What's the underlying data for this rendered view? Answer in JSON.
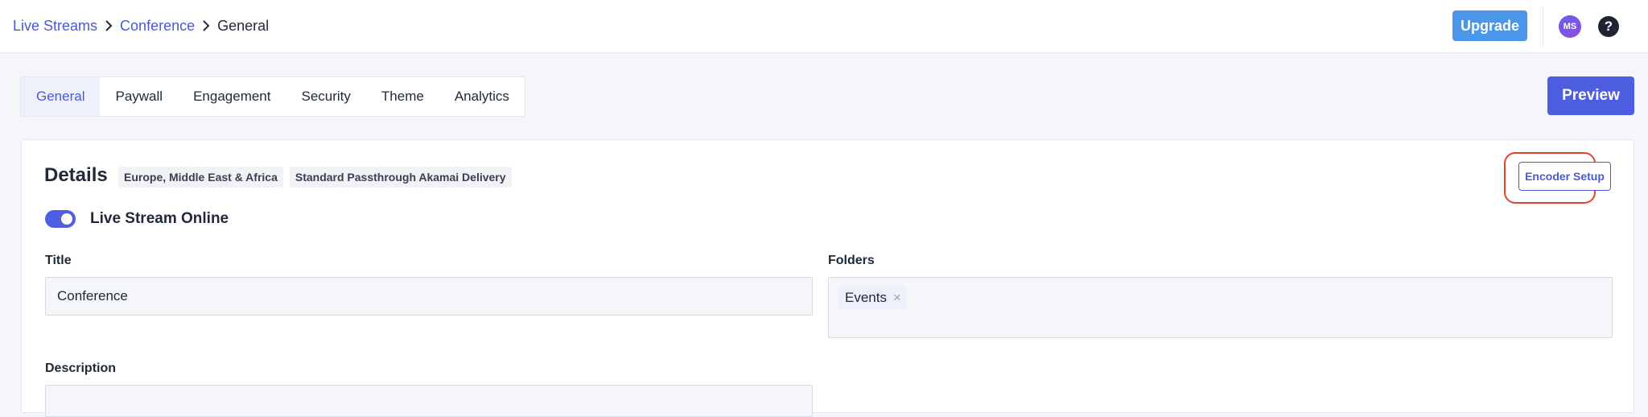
{
  "breadcrumb": {
    "items": [
      {
        "label": "Live Streams"
      },
      {
        "label": "Conference"
      },
      {
        "label": "General"
      }
    ]
  },
  "header": {
    "upgrade_label": "Upgrade",
    "avatar_initials": "MS",
    "help_icon": "question-circle-icon",
    "help_glyph": "?"
  },
  "tabs": [
    {
      "label": "General",
      "active": true
    },
    {
      "label": "Paywall"
    },
    {
      "label": "Engagement"
    },
    {
      "label": "Security"
    },
    {
      "label": "Theme"
    },
    {
      "label": "Analytics"
    }
  ],
  "preview_label": "Preview",
  "details": {
    "title": "Details",
    "badges": [
      "Europe, Middle East & Africa",
      "Standard Passthrough Akamai Delivery"
    ],
    "encoder_setup_label": "Encoder Setup",
    "toggle_label": "Live Stream Online",
    "toggle_on": true
  },
  "form": {
    "title_label": "Title",
    "title_value": "Conference",
    "folders_label": "Folders",
    "folder_chips": [
      "Events"
    ],
    "chip_close_glyph": "×",
    "description_label": "Description"
  },
  "colors": {
    "accent": "#4e5ee0",
    "link": "#4a5ad8",
    "upgrade": "#4a97ea",
    "highlight": "#e0452a"
  }
}
